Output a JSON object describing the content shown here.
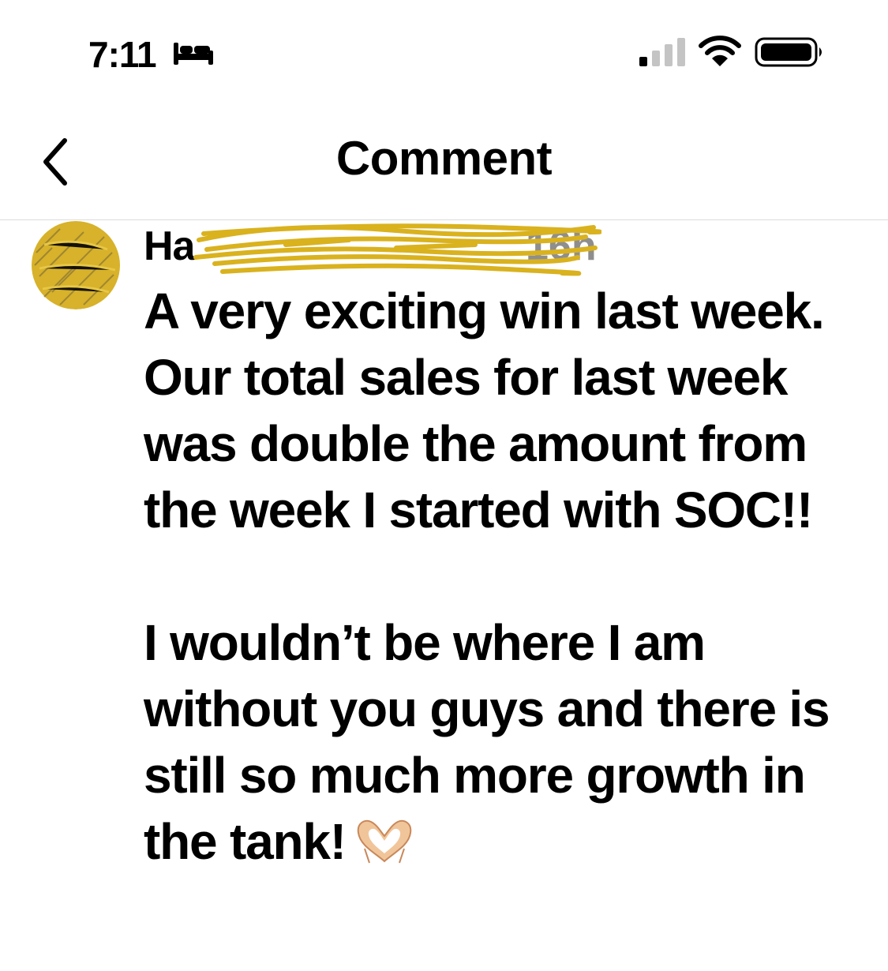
{
  "status_bar": {
    "time": "7:11",
    "sleep_icon": "bed-icon",
    "signal_icon": "cellular-signal-icon",
    "wifi_icon": "wifi-icon",
    "battery_icon": "battery-icon"
  },
  "nav": {
    "back_icon": "chevron-left-icon",
    "title": "Comment"
  },
  "comment": {
    "author_visible": "Ha",
    "timestamp": "16h",
    "paragraph_1": "A very exciting win last week. Our total sales for last week was double the amount from the week I started with SOC!!",
    "paragraph_2": "I wouldn’t be where I am without you guys and there is still so much more growth in the tank!",
    "emoji_icon": "heart-hands-icon"
  },
  "colors": {
    "background": "#ffffff",
    "text": "#000000",
    "timestamp": "#8e8e8e",
    "redaction_scribble": "#d9b21e",
    "divider": "#dcdcdc"
  }
}
